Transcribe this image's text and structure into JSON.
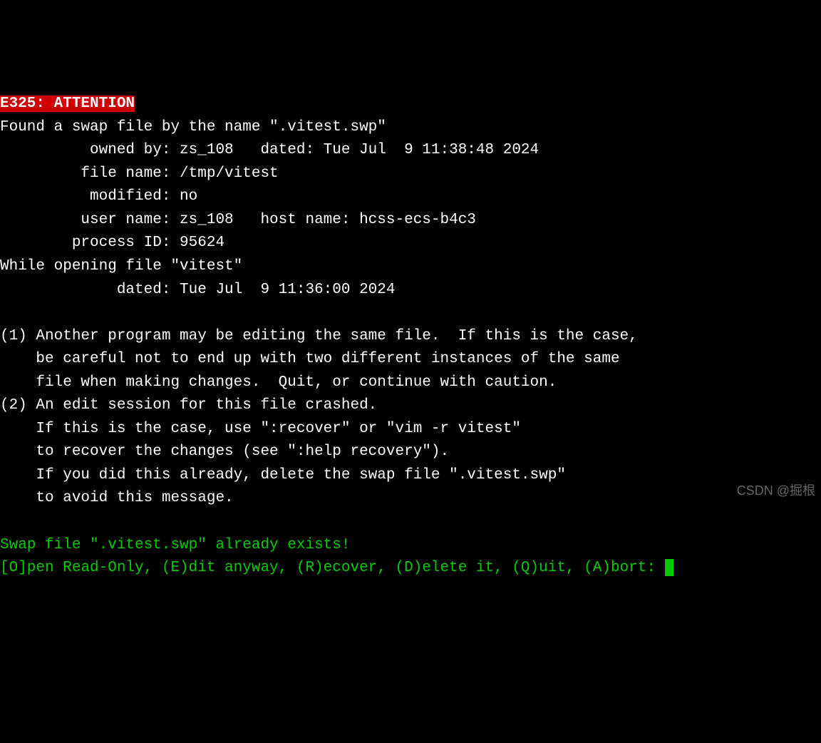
{
  "header": {
    "error_code": "E325: ATTENTION"
  },
  "swap_info": {
    "found_line": "Found a swap file by the name \".vitest.swp\"",
    "owned_by_line": "          owned by: zs_108   dated: Tue Jul  9 11:38:48 2024",
    "file_name_line": "         file name: /tmp/vitest",
    "modified_line": "          modified: no",
    "user_host_line": "         user name: zs_108   host name: hcss-ecs-b4c3",
    "process_id_line": "        process ID: 95624",
    "opening_line": "While opening file \"vitest\"",
    "dated_line": "             dated: Tue Jul  9 11:36:00 2024"
  },
  "blank1": "",
  "warnings": {
    "w1_l1": "(1) Another program may be editing the same file.  If this is the case,",
    "w1_l2": "    be careful not to end up with two different instances of the same",
    "w1_l3": "    file when making changes.  Quit, or continue with caution.",
    "w2_l1": "(2) An edit session for this file crashed.",
    "w2_l2": "    If this is the case, use \":recover\" or \"vim -r vitest\"",
    "w2_l3": "    to recover the changes (see \":help recovery\").",
    "w2_l4": "    If you did this already, delete the swap file \".vitest.swp\"",
    "w2_l5": "    to avoid this message."
  },
  "blank2": "",
  "status": {
    "exists_line": "Swap file \".vitest.swp\" already exists!",
    "prompt_line": "[O]pen Read-Only, (E)dit anyway, (R)ecover, (D)elete it, (Q)uit, (A)bort: "
  },
  "watermark": "CSDN @掘根"
}
